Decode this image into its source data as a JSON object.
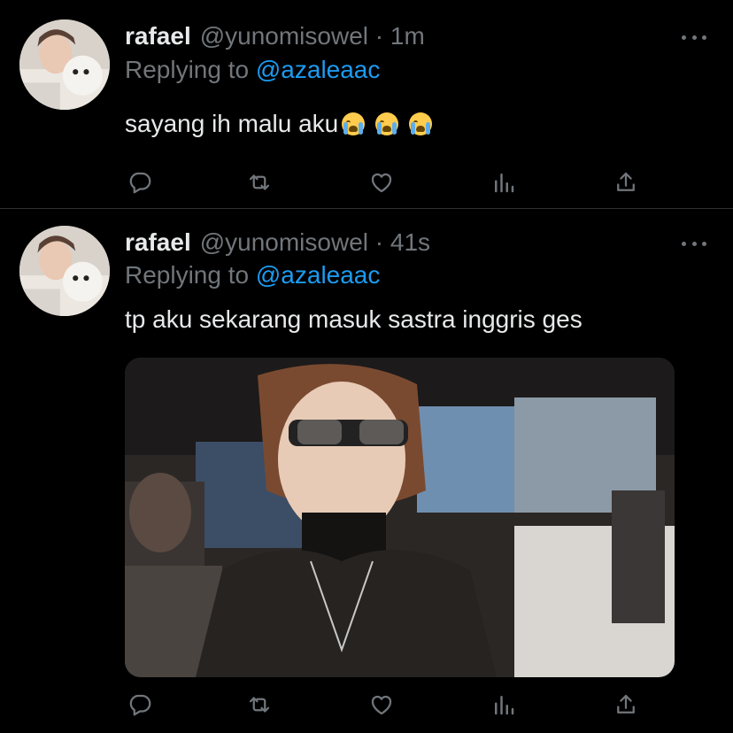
{
  "tweets": [
    {
      "display_name": "rafael",
      "handle": "@yunomisowel",
      "separator": "·",
      "time": "1m",
      "replying_prefix": "Replying to",
      "replying_to": "@azaleaac",
      "text": "sayang ih malu aku",
      "emoji": [
        "loudly-crying-face",
        "loudly-crying-face",
        "loudly-crying-face"
      ],
      "has_media": false
    },
    {
      "display_name": "rafael",
      "handle": "@yunomisowel",
      "separator": "·",
      "time": "41s",
      "replying_prefix": "Replying to",
      "replying_to": "@azaleaac",
      "text": "tp aku sekarang masuk sastra inggris ges",
      "emoji": [],
      "has_media": true
    }
  ],
  "action_icons": [
    "reply-icon",
    "retweet-icon",
    "like-icon",
    "views-icon",
    "share-icon"
  ],
  "colors": {
    "background": "#000000",
    "text_primary": "#e7e9ea",
    "text_secondary": "#71767b",
    "accent": "#1d9bf0",
    "divider": "#2f3336"
  }
}
